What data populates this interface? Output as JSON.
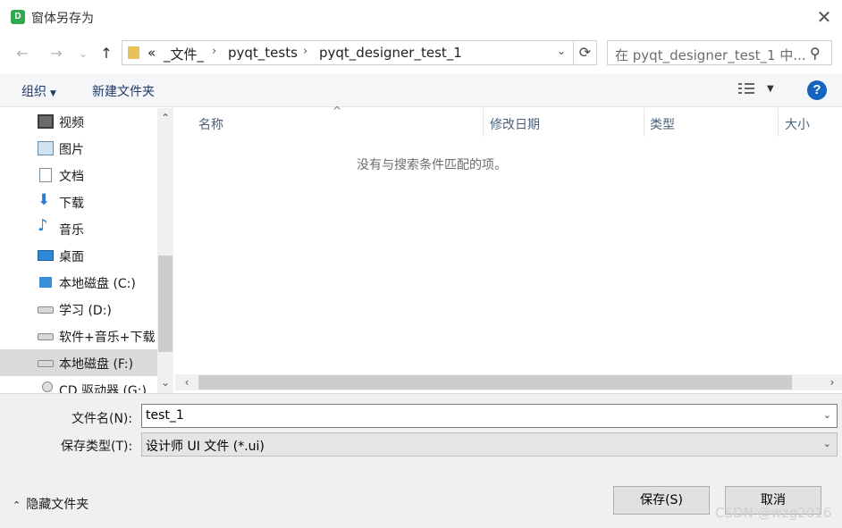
{
  "window": {
    "app_icon_letter": "D",
    "title": "窗体另存为",
    "close_glyph": "✕"
  },
  "nav": {
    "back_glyph": "←",
    "forward_glyph": "→",
    "recent_glyph": "⌄",
    "up_glyph": "↑",
    "breadcrumbs": [
      "«",
      "_文件_",
      "pyqt_tests",
      "pyqt_designer_test_1"
    ],
    "crumb_sep": "›",
    "dropdown_glyph": "⌄",
    "refresh_glyph": "⟳",
    "search_placeholder": "在 pyqt_designer_test_1 中...",
    "search_glyph": "⚲"
  },
  "toolbar": {
    "organize_label": "组织",
    "new_folder_label": "新建文件夹",
    "help_label": "?"
  },
  "sidebar": {
    "items": [
      {
        "label": "视频",
        "icon": "video-icon"
      },
      {
        "label": "图片",
        "icon": "image-icon"
      },
      {
        "label": "文档",
        "icon": "document-icon"
      },
      {
        "label": "下载",
        "icon": "download-icon",
        "glyph": "⬇"
      },
      {
        "label": "音乐",
        "icon": "music-icon",
        "glyph": "♪"
      },
      {
        "label": "桌面",
        "icon": "desktop-icon"
      },
      {
        "label": "本地磁盘 (C:)",
        "icon": "windows-drive-icon"
      },
      {
        "label": "学习 (D:)",
        "icon": "drive-icon"
      },
      {
        "label": "软件+音乐+下载",
        "icon": "drive-icon"
      },
      {
        "label": "本地磁盘 (F:)",
        "icon": "drive-icon",
        "selected": true
      },
      {
        "label": "CD 驱动器 (G:)",
        "icon": "cd-drive-icon"
      }
    ],
    "scroll_up_glyph": "⌃",
    "scroll_down_glyph": "⌄"
  },
  "filelist": {
    "columns": [
      "名称",
      "修改日期",
      "类型",
      "大小"
    ],
    "sort_glyph": "^",
    "empty_message": "没有与搜索条件匹配的项。",
    "hscroll_left_glyph": "‹",
    "hscroll_right_glyph": "›"
  },
  "form": {
    "filename_label": "文件名(N):",
    "filename_value": "test_1",
    "filetype_label": "保存类型(T):",
    "filetype_value": "设计师 UI 文件 (*.ui)",
    "dropdown_glyph": "⌄"
  },
  "footer": {
    "hide_folders_caret": "⌃",
    "hide_folders_label": "隐藏文件夹",
    "save_label": "保存(S)",
    "cancel_label": "取消",
    "watermark": "CSDN @wzg2016"
  }
}
